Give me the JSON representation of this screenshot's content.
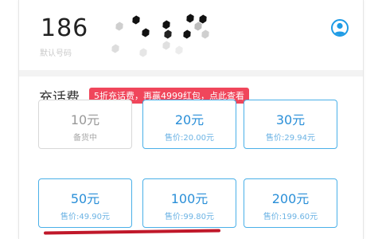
{
  "account": {
    "phone_prefix": "186",
    "sub_label": "默认号码"
  },
  "recharge": {
    "title": "充话费",
    "promo": "5折充话费，再赢4999红包，点此查看",
    "options": [
      {
        "amount": "10元",
        "price": "备货中",
        "available": false
      },
      {
        "amount": "20元",
        "price": "售价:20.00元",
        "available": true
      },
      {
        "amount": "30元",
        "price": "售价:29.94元",
        "available": true
      },
      {
        "amount": "50元",
        "price": "售价:49.90元",
        "available": true
      },
      {
        "amount": "100元",
        "price": "售价:99.80元",
        "available": true
      },
      {
        "amount": "200元",
        "price": "售价:199.60元",
        "available": true
      }
    ]
  },
  "colors": {
    "accent": "#2a8fd8",
    "tile_border": "#4ab0e8",
    "promo_bg": "#f0465b",
    "annotation": "#c0182a"
  }
}
